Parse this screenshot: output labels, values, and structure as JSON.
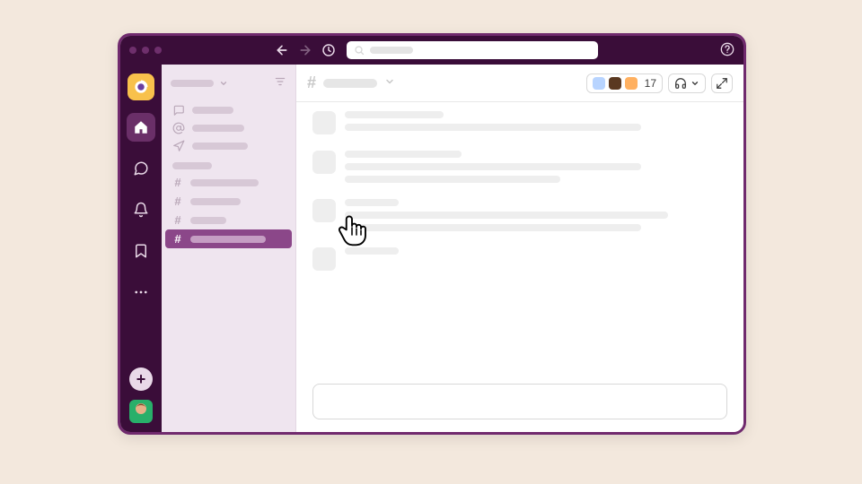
{
  "colors": {
    "brand": "#3a0d39",
    "accent": "#8b4789",
    "page_bg": "#f3e8dd",
    "workspace_badge": "#f8c14c"
  },
  "titlebar": {
    "search_placeholder": ""
  },
  "rail": {
    "icons": [
      "workspace",
      "home",
      "dm",
      "activity",
      "bookmark",
      "more"
    ],
    "add_label": "+"
  },
  "sidebar": {
    "sections": {
      "top_items": [
        "threads",
        "mentions",
        "drafts"
      ],
      "channels_heading": "",
      "channels": [
        {
          "label": "",
          "active": false
        },
        {
          "label": "",
          "active": false
        },
        {
          "label": "",
          "active": false
        },
        {
          "label": "",
          "active": true
        }
      ]
    }
  },
  "channel_header": {
    "hash": "#",
    "name": "",
    "member_count": "17"
  },
  "messages": [
    {
      "lines": [
        110,
        330
      ]
    },
    {
      "lines": [
        130,
        330,
        240
      ]
    },
    {
      "lines": [
        60,
        360,
        330
      ]
    },
    {
      "lines": [
        60
      ]
    }
  ],
  "composer": {
    "placeholder": ""
  }
}
